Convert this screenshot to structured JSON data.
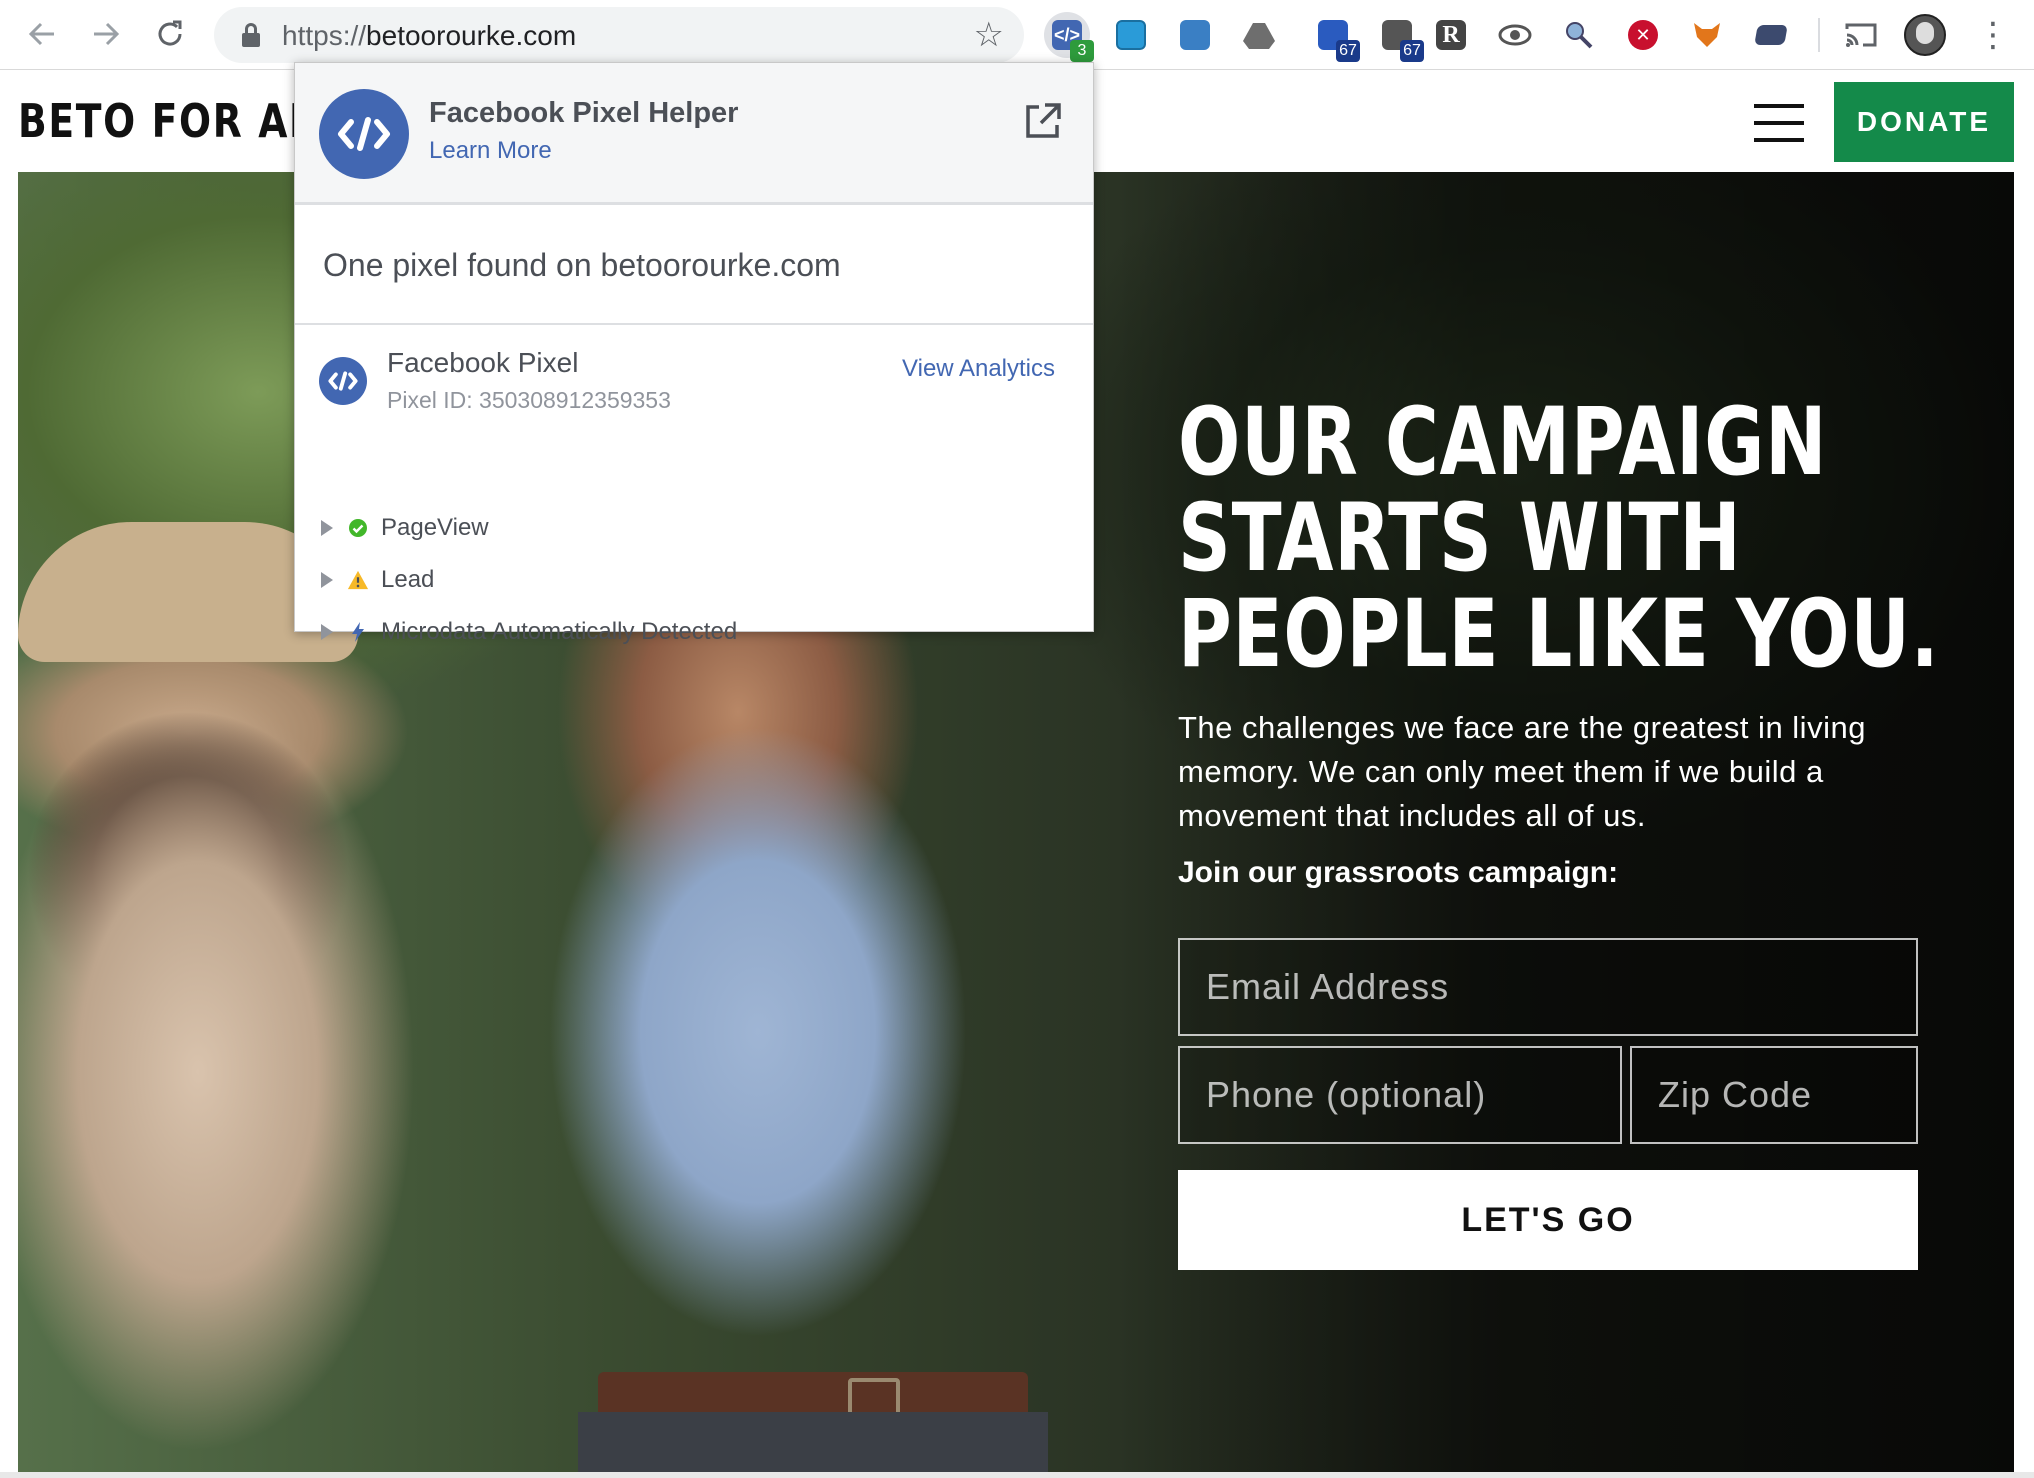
{
  "browser": {
    "url_scheme": "https://",
    "url_host": "betoorourke.com",
    "extensions": [
      {
        "name": "facebook-pixel-helper",
        "badge": "3",
        "active": true
      },
      {
        "name": "window-ext",
        "badge": ""
      },
      {
        "name": "screenshot-ext",
        "badge": ""
      },
      {
        "name": "drive-ext",
        "badge": ""
      },
      {
        "name": "tag-ext",
        "badge": "67"
      },
      {
        "name": "sitemap-ext",
        "badge": "67"
      },
      {
        "name": "r-ext",
        "badge": ""
      },
      {
        "name": "eye-ext",
        "badge": ""
      },
      {
        "name": "search-ext",
        "badge": ""
      },
      {
        "name": "blocker-ext",
        "badge": ""
      },
      {
        "name": "fox-ext",
        "badge": ""
      },
      {
        "name": "card-ext",
        "badge": ""
      }
    ],
    "colors": {
      "active_badge": "#2e9b3c",
      "count_badge": "#1a3a8a"
    }
  },
  "site": {
    "brand": "BETO FOR AMEI",
    "donate_label": "DONATE",
    "headline": [
      "OUR CAMPAIGN",
      "STARTS WITH",
      "PEOPLE LIKE YOU."
    ],
    "subtext": "The challenges we face are the greatest in living memory. We can only meet them if we build a movement that includes all of us.",
    "join": "Join our grassroots campaign:",
    "email_placeholder": "Email Address",
    "phone_placeholder": "Phone (optional)",
    "zip_placeholder": "Zip Code",
    "submit_label": "LET'S GO",
    "colors": {
      "donate": "#148a4a"
    }
  },
  "popup": {
    "title": "Facebook Pixel Helper",
    "learn_more": "Learn More",
    "found_text": "One pixel found on betoorourke.com",
    "pixel_name": "Facebook Pixel",
    "pixel_id": "Pixel ID: 350308912359353",
    "view_analytics": "View Analytics",
    "events": [
      {
        "label": "PageView",
        "status": "success"
      },
      {
        "label": "Lead",
        "status": "warning"
      },
      {
        "label": "Microdata Automatically Detected",
        "status": "info"
      }
    ],
    "colors": {
      "brand": "#4267b2",
      "success": "#42b72a",
      "warning": "#f7b928",
      "info": "#4267b2"
    }
  }
}
